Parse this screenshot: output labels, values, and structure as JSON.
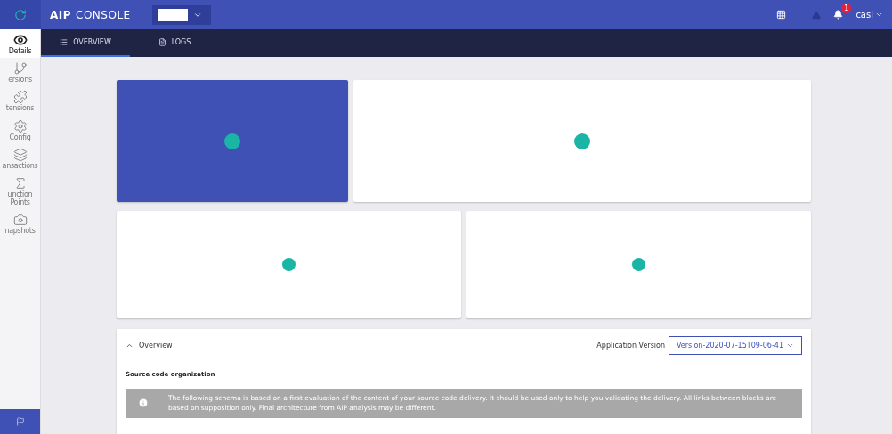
{
  "header": {
    "brand_bold": "AIP",
    "brand": "CONSOLE",
    "user": "casl",
    "notification_count": "1"
  },
  "tabs": [
    {
      "label": "OVERVIEW",
      "selected": true,
      "kind": "list"
    },
    {
      "label": "LOGS",
      "selected": false,
      "kind": "doc"
    }
  ],
  "sidebar": {
    "items": [
      {
        "label": "Details",
        "kind": "eye",
        "selected": true
      },
      {
        "label": "ersions",
        "kind": "branch",
        "selected": false
      },
      {
        "label": "tensions",
        "kind": "puzzle",
        "selected": false
      },
      {
        "label": "Config",
        "kind": "gear",
        "selected": false
      },
      {
        "label": "ansactions",
        "kind": "layers",
        "selected": false
      },
      {
        "label": "unction Points",
        "kind": "function",
        "selected": false
      },
      {
        "label": "napshots",
        "kind": "camera",
        "selected": false
      }
    ]
  },
  "cards": [
    {
      "kind": "highlight"
    },
    {
      "kind": "plain"
    },
    {
      "kind": "plain"
    },
    {
      "kind": "plain"
    }
  ],
  "overview": {
    "title": "Overview",
    "expanded": true,
    "version_label": "Application Version",
    "version_value": "Version-2020-07-15T09-06-41",
    "section_title": "Source code organization",
    "notice": "The following schema is based on a first evaluation of the content of your source code delivery. It should be used only to help you validating the delivery. All links between blocks are based on supposition only. Final architecture from AIP analysis may be different."
  }
}
